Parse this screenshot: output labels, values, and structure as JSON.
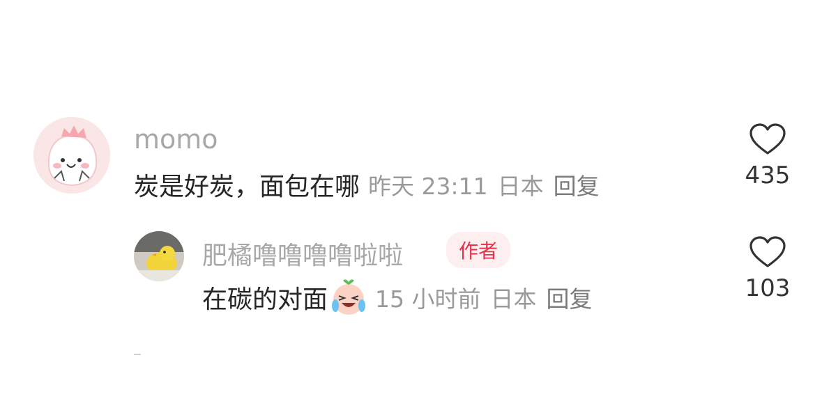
{
  "comments": [
    {
      "username": "momo",
      "text": "炭是好炭，面包在哪",
      "time": "昨天 23:11",
      "location": "日本",
      "reply_label": "回复",
      "likes": "435",
      "avatar_icon": "pink-blob-character-avatar"
    }
  ],
  "reply": {
    "username": "肥橘噜噜噜噜啦啦",
    "badge": "作者",
    "text": "在碳的对面",
    "emoji_icon": "crying-laughing-peach-emoji",
    "time": "15 小时前",
    "location": "日本",
    "reply_label": "回复",
    "likes": "103",
    "avatar_icon": "yellow-duck-photo-avatar"
  },
  "colors": {
    "username": "#a8a8a8",
    "body": "#262626",
    "meta": "#9a9a9a",
    "badge_bg": "#fdeef0",
    "badge_text": "#e8304a"
  }
}
